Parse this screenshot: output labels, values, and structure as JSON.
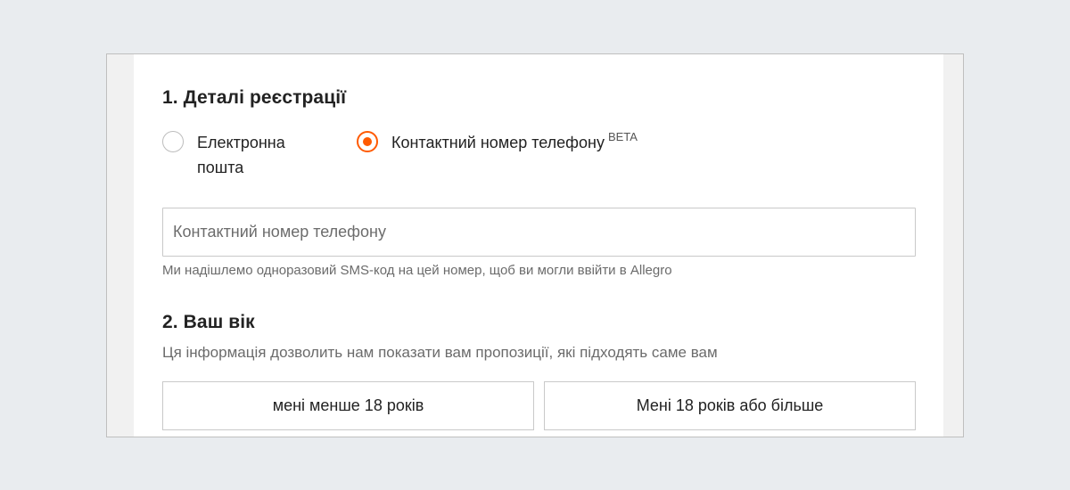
{
  "registration": {
    "title": "1. Деталі реєстрації",
    "options": [
      {
        "label": "Електронна пошта",
        "selected": false
      },
      {
        "label": "Контактний номер телефону",
        "badge": "BETA",
        "selected": true
      }
    ],
    "phone_input": {
      "placeholder": "Контактний номер телефону",
      "value": ""
    },
    "hint": "Ми надішлемо одноразовий SMS-код на цей номер, щоб ви могли ввійти в Allegro"
  },
  "age": {
    "title": "2. Ваш вік",
    "description": "Ця інформація дозволить нам показати вам пропозиції, які підходять саме вам",
    "buttons": [
      "мені менше 18 років",
      "Мені 18 років або більше"
    ]
  },
  "colors": {
    "accent": "#ff5a00",
    "background": "#e9ecef",
    "card": "#ffffff"
  },
  "icons": {
    "radio_checked": "radio-checked-icon",
    "radio_unchecked": "radio-unchecked-icon"
  }
}
